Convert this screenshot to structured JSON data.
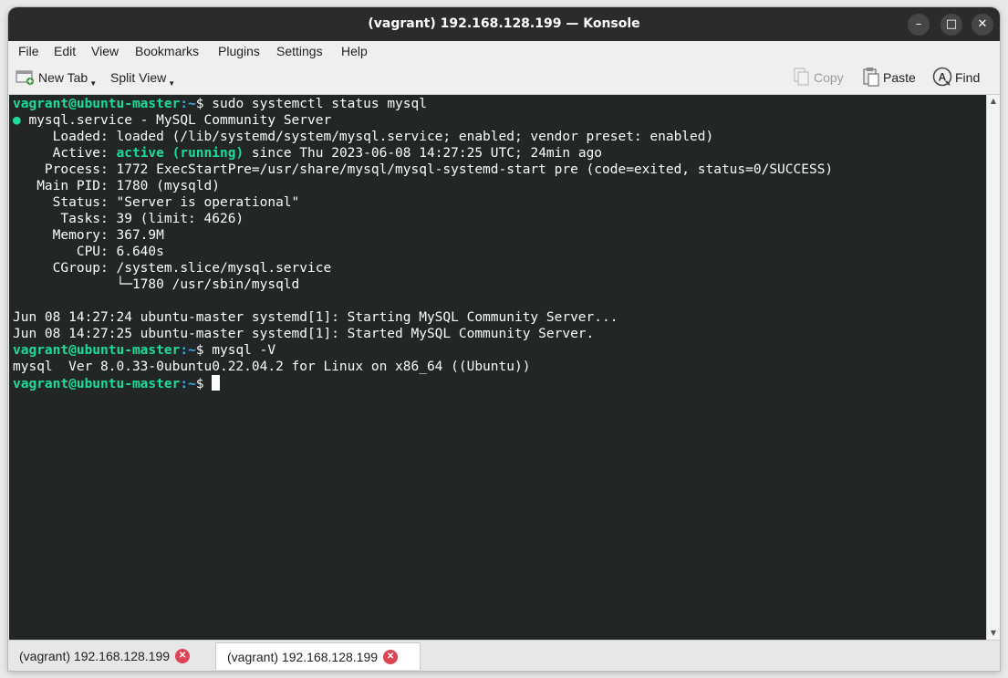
{
  "window": {
    "title": "(vagrant) 192.168.128.199 — Konsole",
    "controls": {
      "minimize": "–",
      "maximize": "□",
      "close": "✕"
    }
  },
  "menu": [
    "File",
    "Edit",
    "View",
    "Bookmarks",
    "Plugins",
    "Settings",
    "Help"
  ],
  "toolbar": {
    "new_tab": "New Tab",
    "split_view": "Split View",
    "copy": "Copy",
    "paste": "Paste",
    "find": "Find"
  },
  "terminal": {
    "prompt_user": "vagrant@ubuntu-master",
    "prompt_path": ":~",
    "prompt_symbol": "$ ",
    "cmd1": "sudo systemctl status mysql",
    "service_dot": "●",
    "service_line": " mysql.service - MySQL Community Server",
    "loaded_line": "     Loaded: loaded (/lib/systemd/system/mysql.service; enabled; vendor preset: enabled)",
    "active_label": "     Active: ",
    "active_state": "active (running)",
    "active_rest": " since Thu 2023-06-08 14:27:25 UTC; 24min ago",
    "process_line": "    Process: 1772 ExecStartPre=/usr/share/mysql/mysql-systemd-start pre (code=exited, status=0/SUCCESS)",
    "mainpid_line": "   Main PID: 1780 (mysqld)",
    "status_line": "     Status: \"Server is operational\"",
    "tasks_line": "      Tasks: 39 (limit: 4626)",
    "memory_line": "     Memory: 367.9M",
    "cpu_line": "        CPU: 6.640s",
    "cgroup_line": "     CGroup: /system.slice/mysql.service",
    "cgroup_child": "             └─1780 /usr/sbin/mysqld",
    "log1": "Jun 08 14:27:24 ubuntu-master systemd[1]: Starting MySQL Community Server...",
    "log2": "Jun 08 14:27:25 ubuntu-master systemd[1]: Started MySQL Community Server.",
    "cmd2": "mysql -V",
    "version_line": "mysql  Ver 8.0.33-0ubuntu0.22.04.2 for Linux on x86_64 ((Ubuntu))"
  },
  "tabs": [
    {
      "label": "(vagrant) 192.168.128.199"
    },
    {
      "label": "(vagrant) 192.168.128.199"
    }
  ],
  "icons": {
    "new_tab": "new-tab-icon",
    "copy": "copy-icon",
    "paste": "paste-icon",
    "find": "find-icon"
  },
  "colors": {
    "terminal_bg": "#232627",
    "terminal_fg": "#fcfcfc",
    "prompt_green": "#1cdc9a",
    "prompt_blue": "#3daee9",
    "titlebar_bg": "#2b2b2b",
    "tab_close": "#da4453"
  }
}
